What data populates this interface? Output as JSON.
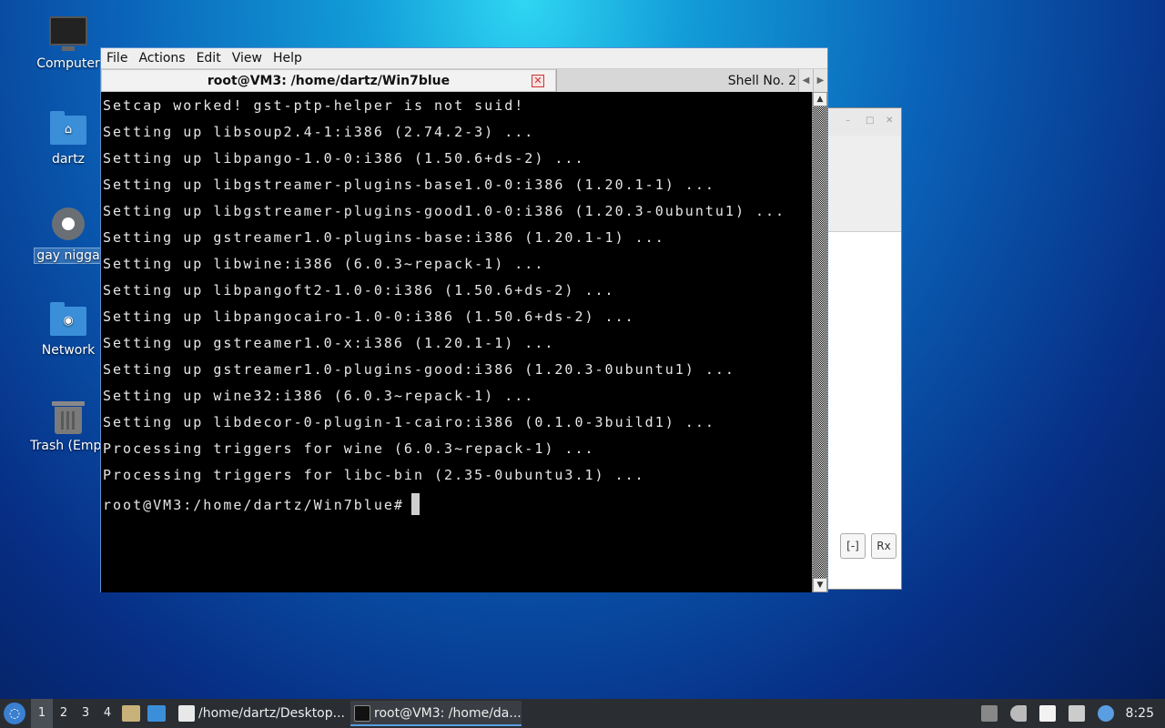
{
  "desktop": {
    "icons": [
      {
        "label": "Computer",
        "icon": "computer-icon"
      },
      {
        "label": "dartz",
        "icon": "home-folder-icon"
      },
      {
        "label": "gay nigga",
        "icon": "settings-gear-icon"
      },
      {
        "label": "Network",
        "icon": "network-folder-icon"
      },
      {
        "label": "Trash (Empt",
        "icon": "trash-icon"
      }
    ]
  },
  "terminal": {
    "menu": [
      "File",
      "Actions",
      "Edit",
      "View",
      "Help"
    ],
    "active_tab": "root@VM3: /home/dartz/Win7blue",
    "other_tab": "Shell No. 2",
    "lines": [
      "Setcap worked! gst-ptp-helper is not suid!",
      "Setting up libsoup2.4-1:i386 (2.74.2-3) ...",
      "Setting up libpango-1.0-0:i386 (1.50.6+ds-2) ...",
      "Setting up libgstreamer-plugins-base1.0-0:i386 (1.20.1-1) ...",
      "Setting up libgstreamer-plugins-good1.0-0:i386 (1.20.3-0ubuntu1) ...",
      "Setting up gstreamer1.0-plugins-base:i386 (1.20.1-1) ...",
      "Setting up libwine:i386 (6.0.3~repack-1) ...",
      "Setting up libpangoft2-1.0-0:i386 (1.50.6+ds-2) ...",
      "Setting up libpangocairo-1.0-0:i386 (1.50.6+ds-2) ...",
      "Setting up gstreamer1.0-x:i386 (1.20.1-1) ...",
      "Setting up gstreamer1.0-plugins-good:i386 (1.20.3-0ubuntu1) ...",
      "Setting up wine32:i386 (6.0.3~repack-1) ...",
      "Setting up libdecor-0-plugin-1-cairo:i386 (0.1.0-3build1) ...",
      "Processing triggers for wine (6.0.3~repack-1) ...",
      "Processing triggers for libc-bin (2.35-0ubuntu3.1) ..."
    ],
    "prompt": "root@VM3:/home/dartz/Win7blue#"
  },
  "background_window": {
    "buttons": [
      "[-]",
      "Rx"
    ]
  },
  "taskbar": {
    "workspaces": [
      "1",
      "2",
      "3",
      "4"
    ],
    "tasks": [
      {
        "label": "/home/dartz/Desktop...",
        "icon": "text-editor-icon"
      },
      {
        "label": "root@VM3: /home/da...",
        "icon": "terminal-icon"
      }
    ],
    "clock": "8:25"
  },
  "colors": {
    "accent": "#5b8fd0",
    "terminal_bg": "#000000",
    "taskbar_bg": "#2a2d32"
  }
}
